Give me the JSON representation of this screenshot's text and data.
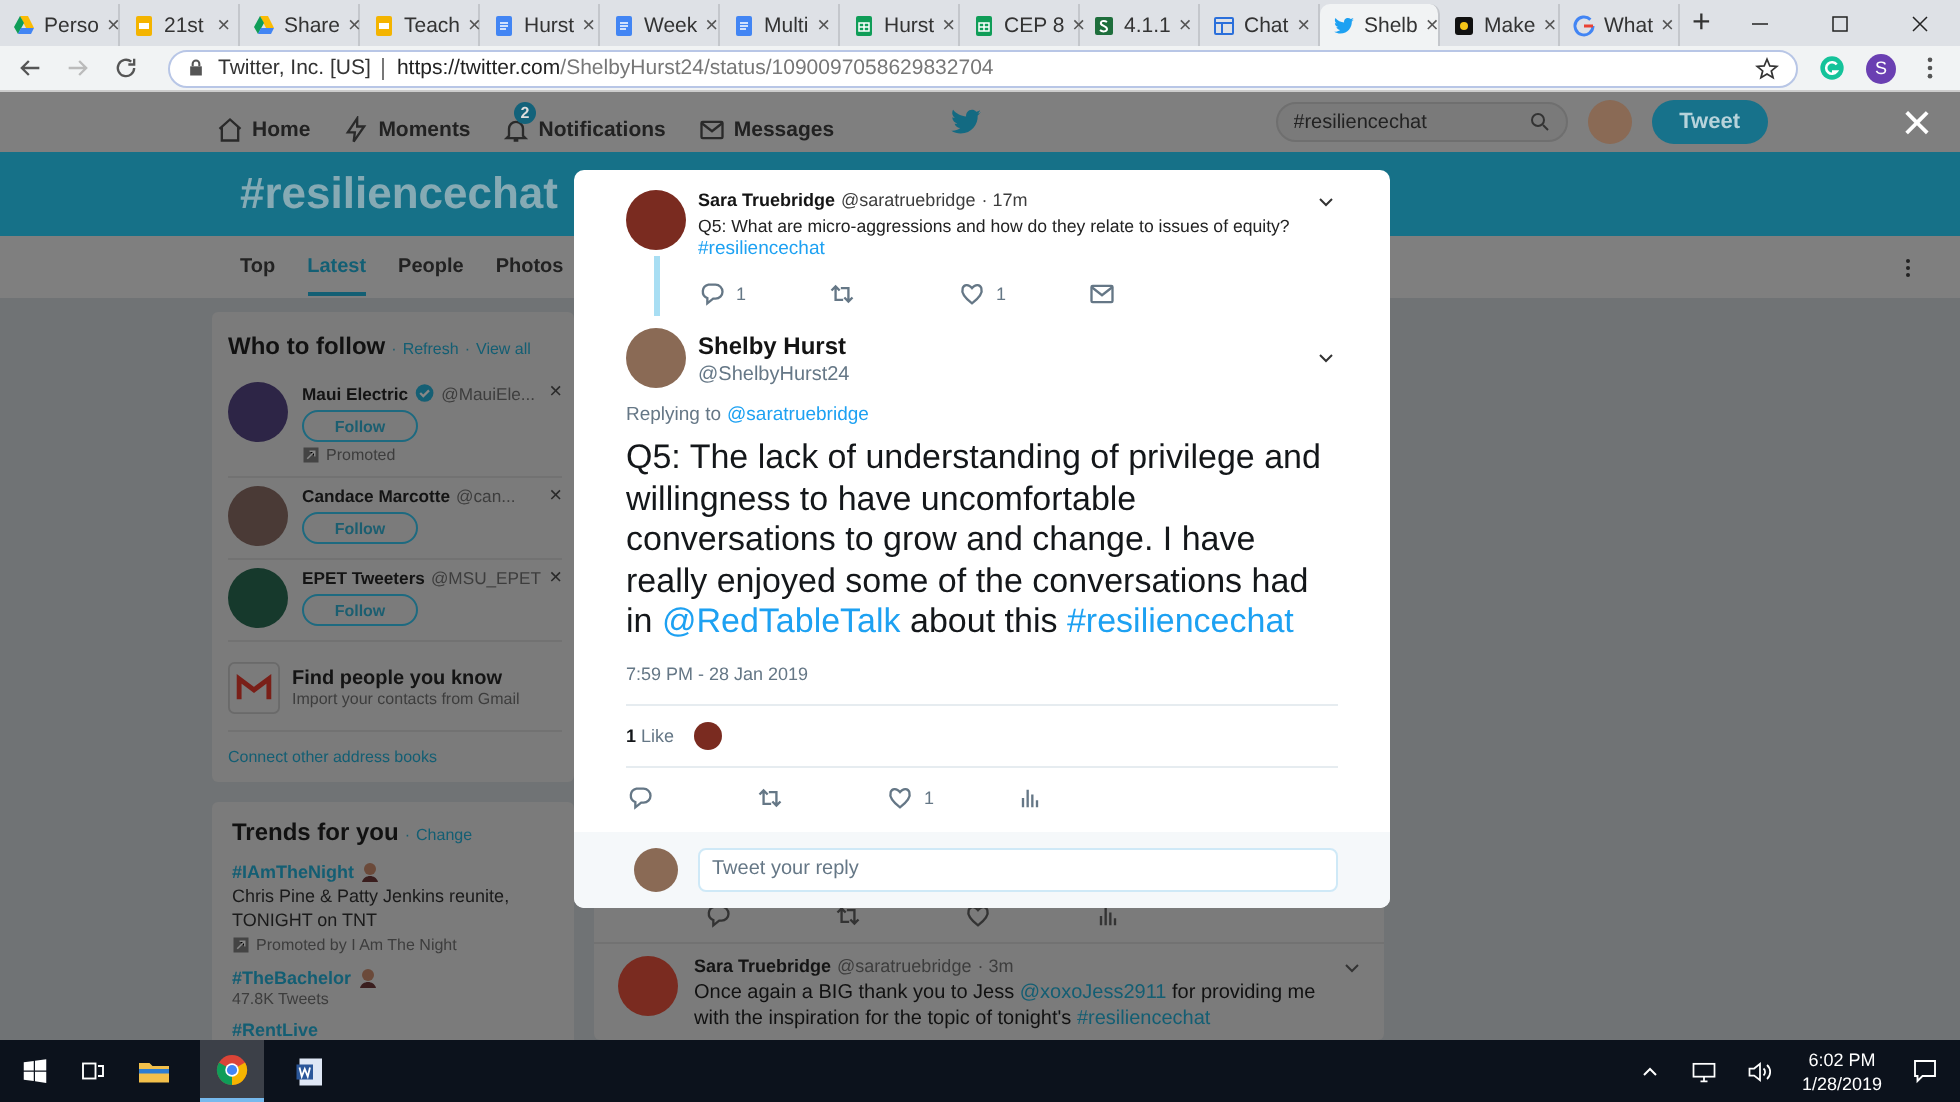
{
  "browser": {
    "tabs": [
      {
        "title": "Perso",
        "kind": "drive",
        "selected": false
      },
      {
        "title": "21st",
        "kind": "slides",
        "selected": false
      },
      {
        "title": "Share",
        "kind": "drive",
        "selected": false
      },
      {
        "title": "Teach",
        "kind": "slides",
        "selected": false
      },
      {
        "title": "Hurst",
        "kind": "docs",
        "selected": false
      },
      {
        "title": "Week",
        "kind": "docs",
        "selected": false
      },
      {
        "title": "Multi",
        "kind": "docs",
        "selected": false
      },
      {
        "title": "Hurst",
        "kind": "sheets",
        "selected": false
      },
      {
        "title": "CEP 8",
        "kind": "sheets",
        "selected": false
      },
      {
        "title": "4.1.1",
        "kind": "schoology",
        "selected": false
      },
      {
        "title": "Chat",
        "kind": "classroom",
        "selected": false
      },
      {
        "title": "Shelb",
        "kind": "twitter",
        "selected": true
      },
      {
        "title": "Make",
        "kind": "sp",
        "selected": false
      },
      {
        "title": "What",
        "kind": "google",
        "selected": false
      }
    ],
    "tab_close": "×",
    "new_tab": "+",
    "address": {
      "site_identity": "Twitter, Inc. [US]",
      "url_origin": "https://twitter.com",
      "url_path": "/ShelbyHurst24/status/1090097058629832704"
    },
    "profile_initial": "S"
  },
  "twitter": {
    "nav": [
      {
        "label": "Home",
        "kind": "home"
      },
      {
        "label": "Moments",
        "kind": "bolt"
      },
      {
        "label": "Notifications",
        "kind": "bell",
        "badge": "2"
      },
      {
        "label": "Messages",
        "kind": "mail"
      }
    ],
    "search": {
      "value": "#resiliencechat"
    },
    "tweet_button": "Tweet",
    "banner_title": "#resiliencechat",
    "tabs": [
      {
        "label": "Top",
        "selected": false
      },
      {
        "label": "Latest",
        "selected": true
      },
      {
        "label": "People",
        "selected": false
      },
      {
        "label": "Photos",
        "selected": false
      }
    ],
    "who_to_follow": {
      "title": "Who to follow",
      "separator": "·",
      "links": [
        "Refresh",
        "View all"
      ],
      "suggestions": [
        {
          "name": "Maui Electric",
          "verified": true,
          "handle": "@MauiEle...",
          "button": "Follow",
          "promoted": "Promoted",
          "kind": "logo",
          "dismiss": "×"
        },
        {
          "name": "Candace Marcotte",
          "verified": false,
          "handle": "@can...",
          "button": "Follow",
          "kind": "photo",
          "dismiss": "×"
        },
        {
          "name": "EPET Tweeters",
          "verified": false,
          "handle": "@MSU_EPET",
          "button": "Follow",
          "kind": "spartan",
          "dismiss": "×"
        }
      ],
      "find_people": {
        "title": "Find people you know",
        "subtitle": "Import your contacts from Gmail"
      },
      "connect_link": "Connect other address books"
    },
    "trends": {
      "title": "Trends for you",
      "separator": "·",
      "change_link": "Change",
      "items": [
        {
          "tag": "#IAmTheNight",
          "emoji": true,
          "description": "Chris Pine & Patty Jenkins reunite, TONIGHT on TNT",
          "promoted": "Promoted by I Am The Night"
        },
        {
          "tag": "#TheBachelor",
          "emoji": true,
          "count": "47.8K Tweets"
        },
        {
          "tag": "#RentLive",
          "emoji": false
        }
      ]
    },
    "feed_behind": {
      "actions": [
        {
          "kind": "reply"
        },
        {
          "kind": "retweet"
        },
        {
          "kind": "like"
        },
        {
          "kind": "analytics"
        }
      ],
      "tweet": {
        "name": "Sara Truebridge",
        "handle": "@saratruebridge",
        "time": "· 3m",
        "segments": [
          {
            "text": "Once again a BIG thank you to Jess ",
            "link": false
          },
          {
            "text": "@xoxoJess2911",
            "link": true
          },
          {
            "text": "  for providing me with the inspiration for the topic of tonight's ",
            "link": false
          },
          {
            "text": "#resiliencechat",
            "link": true
          }
        ]
      }
    }
  },
  "modal": {
    "close": "×",
    "parent_tweet": {
      "name": "Sara Truebridge",
      "handle": "@saratruebridge",
      "time": "· 17m",
      "text": "Q5:  What are micro-aggressions and how do they relate to issues of equity?",
      "hashtag": "#resiliencechat",
      "actions": [
        {
          "kind": "reply",
          "count": "1"
        },
        {
          "kind": "retweet"
        },
        {
          "kind": "like",
          "count": "1"
        },
        {
          "kind": "message"
        }
      ]
    },
    "tweet": {
      "name": "Shelby Hurst",
      "handle": "@ShelbyHurst24",
      "replying_to": "Replying to",
      "reply_handle": "@saratruebridge",
      "segments": [
        {
          "text": "Q5: The lack of understanding of privilege and willingness to have uncomfortable conversations to grow and change. I have really enjoyed some of the conversations had in ",
          "link": false
        },
        {
          "text": "@RedTableTalk",
          "link": true
        },
        {
          "text": " about this ",
          "link": false
        },
        {
          "text": "#resiliencechat",
          "link": true
        }
      ],
      "timestamp": "7:59 PM - 28 Jan 2019",
      "like_count": "1",
      "like_label": "Like",
      "actions": [
        {
          "kind": "reply"
        },
        {
          "kind": "retweet"
        },
        {
          "kind": "like",
          "count": "1"
        },
        {
          "kind": "analytics"
        }
      ]
    },
    "reply_box": {
      "placeholder": "Tweet your reply"
    }
  },
  "taskbar": {
    "time": "6:02 PM",
    "date": "1/28/2019"
  }
}
